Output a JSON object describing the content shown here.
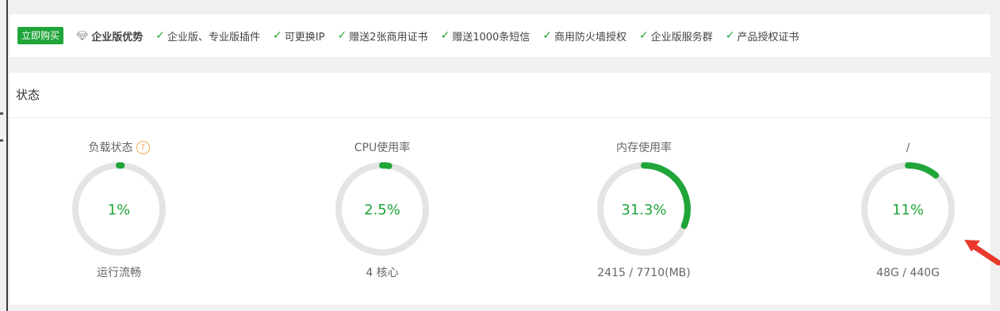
{
  "promo": {
    "buy_label": "立即购买",
    "advantage_label": "企业版优势",
    "features": [
      "企业版、专业版插件",
      "可更换IP",
      "赠送2张商用证书",
      "赠送1000条短信",
      "商用防火墙授权",
      "企业版服务群",
      "产品授权证书"
    ]
  },
  "status": {
    "title": "状态",
    "gauges": [
      {
        "title": "负载状态",
        "value": "1%",
        "percent": 1,
        "detail": "运行流畅",
        "help": "?"
      },
      {
        "title": "CPU使用率",
        "value": "2.5%",
        "percent": 2.5,
        "detail": "4 核心"
      },
      {
        "title": "内存使用率",
        "value": "31.3%",
        "percent": 31.3,
        "detail": "2415 / 7710(MB)"
      },
      {
        "title": "/",
        "value": "11%",
        "percent": 11,
        "detail": "48G / 440G"
      }
    ]
  },
  "colors": {
    "accent": "#20a53a",
    "track": "#e4e4e4",
    "arrow": "#e8392c",
    "help": "#f0ad4e"
  },
  "icons": {
    "diamond": "diamond-icon",
    "check": "check-icon",
    "help": "question-circle-icon",
    "arrow": "red-arrow-icon"
  }
}
